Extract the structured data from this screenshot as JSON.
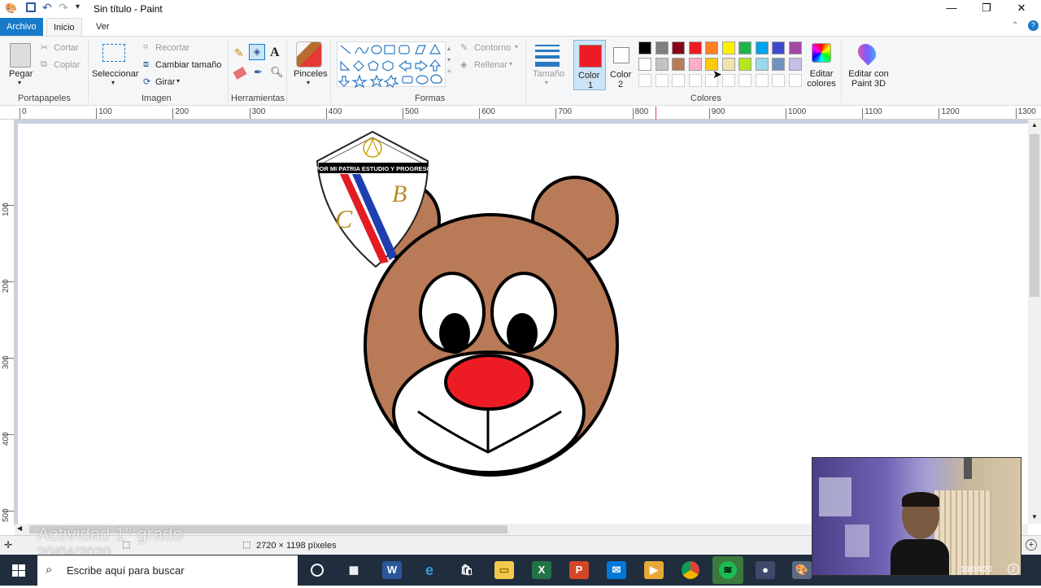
{
  "window": {
    "title": "Sin título - Paint",
    "minimize": "—",
    "restore": "❐",
    "close": "✕"
  },
  "menu": {
    "file": "Archivo",
    "home": "Inicio",
    "view": "Ver"
  },
  "ribbon": {
    "clipboard": {
      "paste": "Pegar",
      "cut": "Cortar",
      "copy": "Copiar",
      "label": "Portapapeles"
    },
    "image": {
      "select": "Seleccionar",
      "crop": "Recortar",
      "resize": "Cambiar tamaño",
      "rotate": "Girar",
      "label": "Imagen"
    },
    "tools": {
      "label": "Herramientas",
      "text_tool": "A"
    },
    "brushes": {
      "label": "Pinceles"
    },
    "shapes": {
      "outline": "Contorno",
      "fill": "Rellenar",
      "label": "Formas"
    },
    "size": {
      "label": "Tamaño"
    },
    "color1": {
      "label": "Color",
      "num": "1",
      "value": "#ed1c24"
    },
    "color2": {
      "label": "Color",
      "num": "2",
      "value": "#ffffff"
    },
    "palette_row1": [
      "#000000",
      "#7f7f7f",
      "#880015",
      "#ed1c24",
      "#ff7f27",
      "#fff200",
      "#22b14c",
      "#00a2e8",
      "#3f48cc",
      "#a349a4"
    ],
    "palette_row2": [
      "#ffffff",
      "#c3c3c3",
      "#b97a57",
      "#ffaec9",
      "#ffc90e",
      "#efe4b0",
      "#b5e61d",
      "#99d9ea",
      "#7092be",
      "#c8bfe7"
    ],
    "colors_label": "Colores",
    "edit_colors": "Editar colores",
    "paint3d": "Editar con Paint 3D"
  },
  "ruler_top": [
    "0",
    "100",
    "200",
    "300",
    "400",
    "500",
    "600",
    "700",
    "800",
    "900",
    "1000",
    "1100",
    "1200",
    "1300"
  ],
  "ruler_left": [
    "100",
    "200",
    "300",
    "400",
    "500"
  ],
  "logo": {
    "motto": "POR MI PATRIA ESTUDIO Y PROGRESO",
    "letter_b": "B",
    "letter_c": "C"
  },
  "status": {
    "size": "2720 × 1198 píxeles"
  },
  "overlay": {
    "title": "Actividad 1° grado",
    "date": "20/04/2020"
  },
  "taskbar": {
    "search_placeholder": "Escribe aquí para buscar",
    "date": "19/04/20",
    "notif_count": "2"
  }
}
